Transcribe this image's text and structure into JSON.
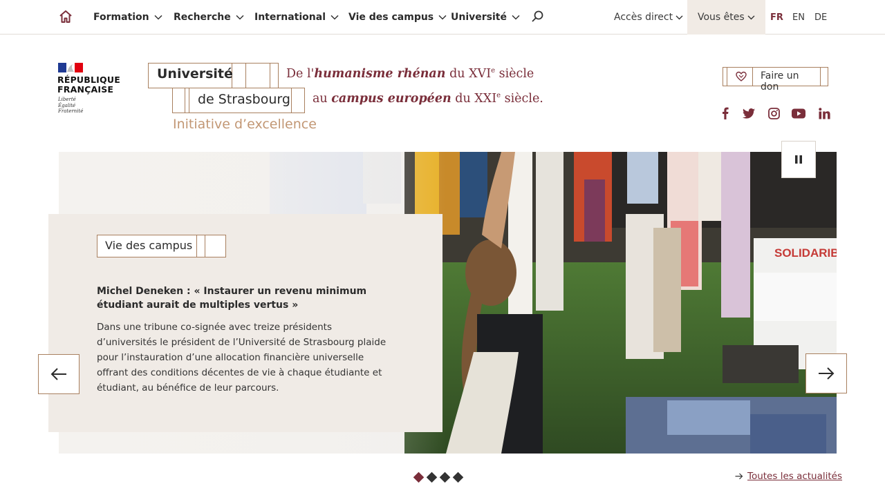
{
  "nav": {
    "items": [
      {
        "label": "Formation"
      },
      {
        "label": "Recherche"
      },
      {
        "label": "International"
      },
      {
        "label": "Vie des campus"
      },
      {
        "label": "Université"
      }
    ],
    "acces_direct": "Accès direct",
    "vous_etes": "Vous êtes",
    "languages": [
      "FR",
      "EN",
      "DE"
    ],
    "active_language": "FR"
  },
  "republique": {
    "title_line1": "RÉPUBLIQUE",
    "title_line2": "FRANÇAISE",
    "motto": [
      "Liberté",
      "Égalité",
      "Fraternité"
    ]
  },
  "logo": {
    "line1": "Université",
    "line2": "de Strasbourg",
    "initiative": "Initiative d’excellence"
  },
  "tagline": {
    "line1_pre": "De l'",
    "line1_em": "humanisme rhénan",
    "line1_post": " du XVI",
    "line1_sup": "e",
    "line1_end": " siècle",
    "line2_pre": "au ",
    "line2_em": "campus européen",
    "line2_post": " du XXI",
    "line2_sup": "e",
    "line2_end": " siècle."
  },
  "don": {
    "label": "Faire un don"
  },
  "social": [
    "facebook-icon",
    "twitter-icon",
    "instagram-icon",
    "youtube-icon",
    "linkedin-icon"
  ],
  "hero": {
    "category": "Vie des campus",
    "title": "Michel Deneken : « Instaurer un revenu minimum étudiant aurait de multiples vertus »",
    "text": "Dans une tribune co-signée avec treize présidents d’universités le président de l’Université de Strasbourg plaide pour l’instauration d’une allocation financière universelle offrant des conditions décentes de vie à chaque étudiante et étudiant, au bénéfice de leur parcours.",
    "sign_text": "SOLIDARIB",
    "slides_count": 4,
    "active_slide": 1
  },
  "toutes_actualites": "Toutes les actualités",
  "colors": {
    "brand": "#7a2e3a",
    "accent": "#a87f5e",
    "card_bg": "#f0ebe6"
  }
}
